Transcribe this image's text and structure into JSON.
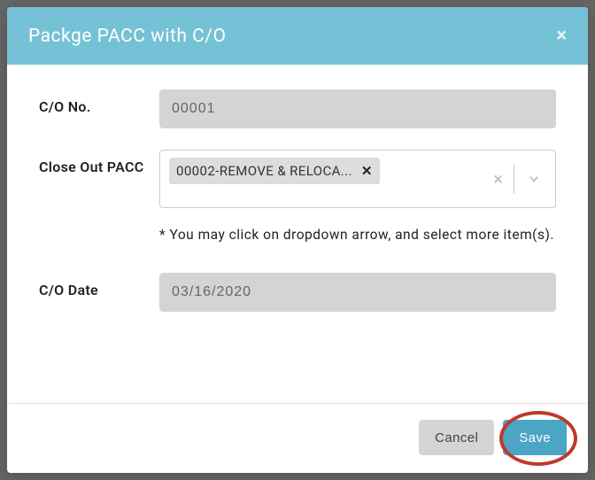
{
  "modal": {
    "title": "Packge PACC with C/O",
    "fields": {
      "co_no": {
        "label": "C/O No.",
        "value": "00001"
      },
      "close_out_pacc": {
        "label": "Close Out PACC",
        "chip_text": "00002-REMOVE & RELOCA...",
        "helper": "* You may click on dropdown arrow, and select more item(s)."
      },
      "co_date": {
        "label": "C/O Date",
        "value": "03/16/2020"
      }
    },
    "buttons": {
      "cancel": "Cancel",
      "save": "Save"
    }
  }
}
